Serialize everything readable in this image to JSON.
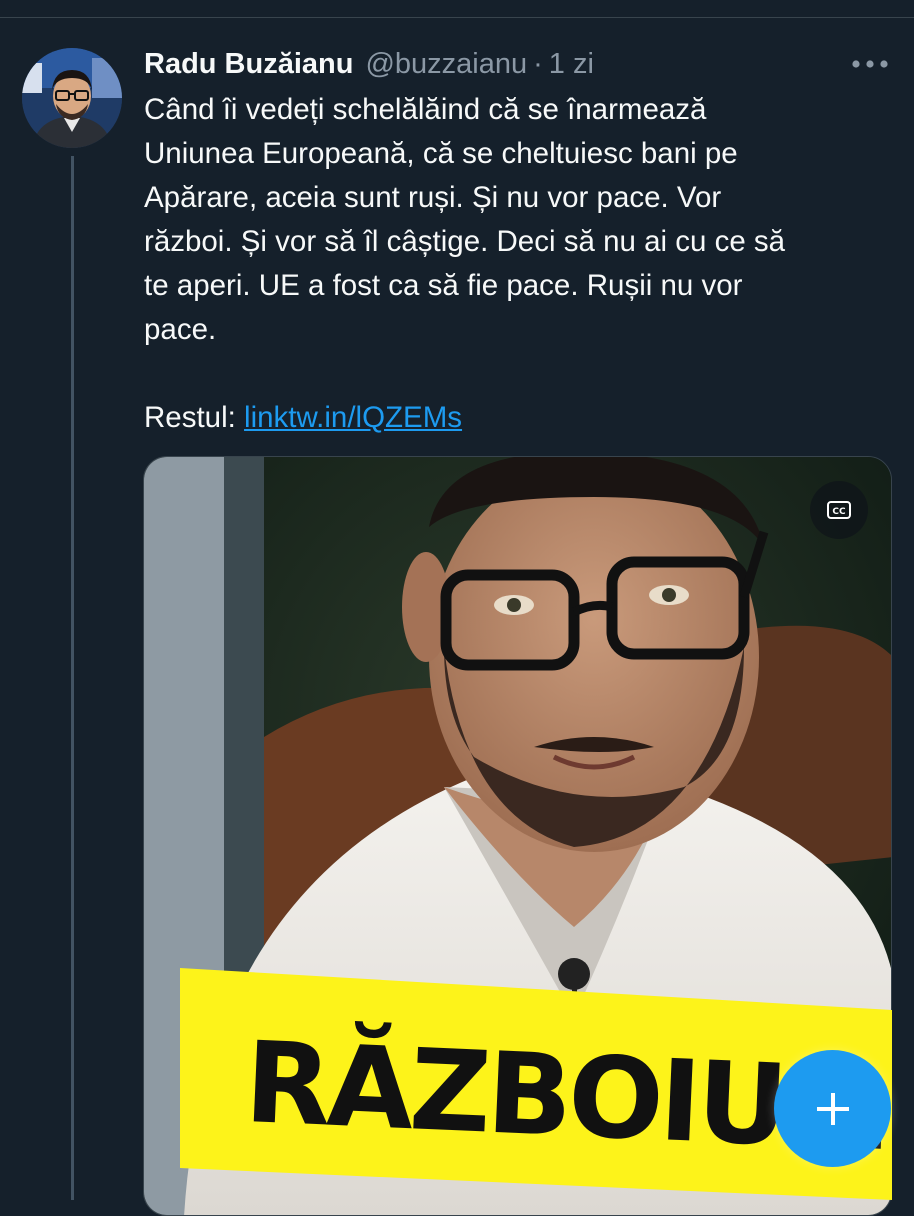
{
  "tweet": {
    "author_name": "Radu Buzăianu",
    "author_handle": "@buzzaianu",
    "separator": "·",
    "time": "1 zi",
    "text_lines": [
      "Când îi vedeți schelălăind că se înarmează",
      "Uniunea Europeană, că se cheltuiesc bani pe",
      "Apărare, aceia sunt ruși. Și nu vor pace. Vor",
      "război. Și vor să îl câștige. Deci să nu ai cu ce să",
      "te aperi. UE a fost ca să fie pace. Rușii nu vor",
      "pace."
    ],
    "rest_label": "Restul:",
    "link_text": "linktw.in/lQZEMs"
  },
  "media": {
    "banner_text": "RĂZBOIUL."
  },
  "colors": {
    "background": "#15202b",
    "text": "#f7f9f9",
    "muted": "#8b98a5",
    "accent": "#1d9bf0",
    "banner": "#fdf31a"
  },
  "icons": {
    "more": "more-horizontal-icon",
    "cc": "closed-captions-icon",
    "compose": "plus-icon"
  }
}
